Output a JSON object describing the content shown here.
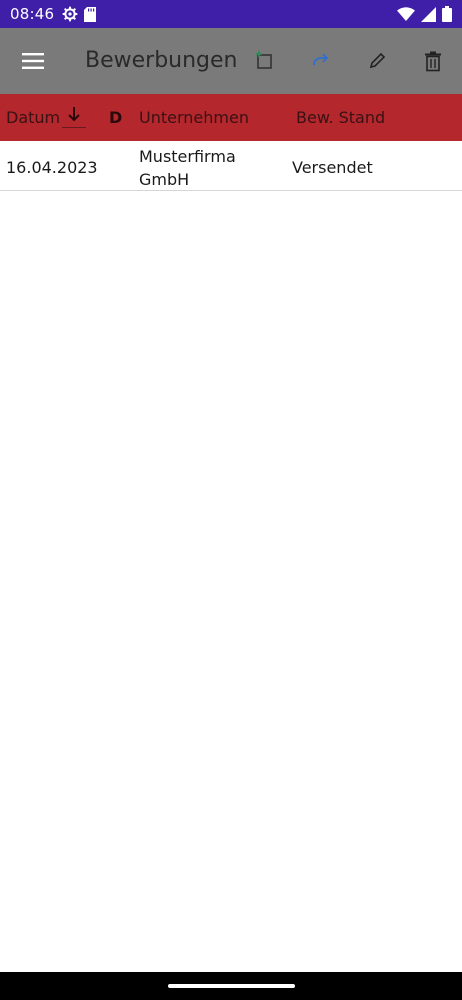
{
  "status_bar": {
    "time": "08:46",
    "icons": [
      "settings-gear-icon",
      "sd-card-icon",
      "wifi-icon",
      "signal-icon",
      "battery-icon"
    ]
  },
  "app_bar": {
    "title": "Bewerbungen",
    "actions": [
      "add-icon",
      "forward-icon",
      "edit-icon",
      "delete-icon"
    ],
    "colors": {
      "background": "#7a7a7a",
      "add": "#2e8b57",
      "forward": "#2f6fd0"
    }
  },
  "table": {
    "colors": {
      "header_background": "#b3272d"
    },
    "columns": {
      "date": "Datum",
      "d": "D",
      "company": "Unternehmen",
      "status": "Bew. Stand"
    },
    "sort_icon": "arrow-down-icon",
    "rows": [
      {
        "date": "16.04.2023",
        "company_line1": "Musterfirma",
        "company_line2": "GmbH",
        "status": "Versendet"
      }
    ]
  }
}
